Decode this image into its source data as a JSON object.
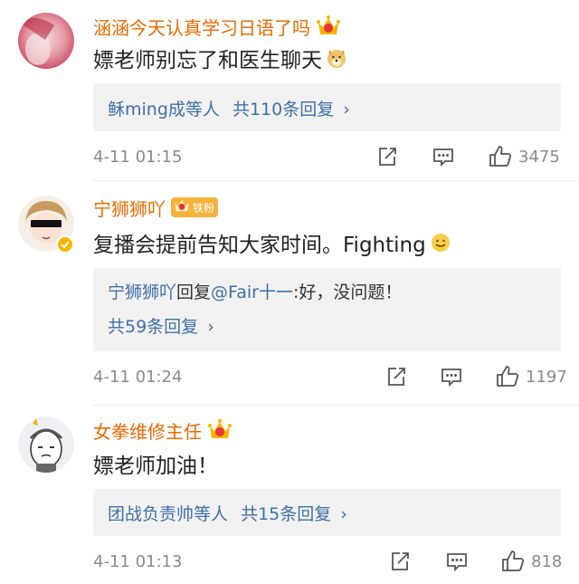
{
  "comments": [
    {
      "username": "涵涵今天认真学习日语了吗",
      "text": "嫖老师别忘了和医生聊天",
      "reply_summary": {
        "names": "稣ming成等人",
        "more": "共110条回复",
        "chevron": "›"
      },
      "time": "4-11 01:15",
      "likes": "3475",
      "icons": [
        "share-icon",
        "comment-icon",
        "like-icon"
      ]
    },
    {
      "username": "宁狮狮吖",
      "fan_badge": "铁粉",
      "text": "复播会提前告知大家时间。Fighting",
      "reply_preview": {
        "author": "宁狮狮吖",
        "verb": "回复",
        "mention": "@Fair十一",
        "content": ":好，没问题！"
      },
      "reply_more": "共59条回复",
      "reply_more_chevron": "›",
      "time": "4-11 01:24",
      "likes": "1197"
    },
    {
      "username": "女拳维修主任",
      "text": "嫖老师加油！",
      "reply_summary": {
        "names": "团战负责帅等人",
        "more": "共15条回复",
        "chevron": "›"
      },
      "time": "4-11 01:13",
      "likes": "818"
    }
  ],
  "colors": {
    "username": "#e86b00",
    "link": "#3f6fa8",
    "meta": "#8a8a8a",
    "reply_bg": "#f2f2f2",
    "fan_badge": "#f6b33c"
  }
}
